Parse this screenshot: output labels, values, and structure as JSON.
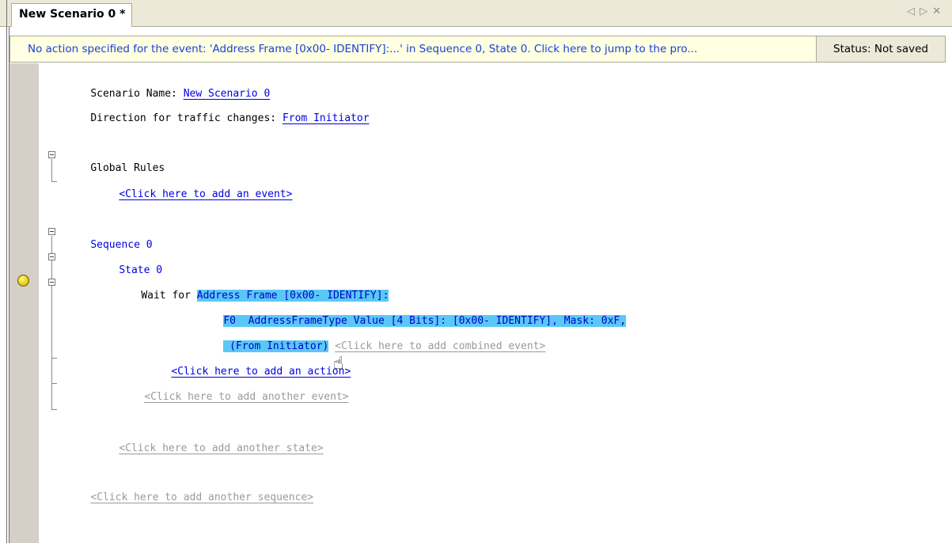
{
  "tab": {
    "title": "New Scenario 0 *",
    "nav_left": "◁",
    "nav_right": "▷",
    "close": "✕"
  },
  "infobar": {
    "message": "No action specified for the event: 'Address Frame [0x00- IDENTIFY]:...' in Sequence 0, State 0.  Click here to jump to the pro...",
    "status": "Status: Not saved"
  },
  "editor": {
    "scenario_name_label": "Scenario Name: ",
    "scenario_name_value": "New Scenario 0",
    "direction_label": "Direction for traffic changes: ",
    "direction_value": "From Initiator",
    "global_rules_label": "Global Rules",
    "add_event": "<Click here to add an event>",
    "sequence_label": "Sequence 0",
    "state_label": "State 0",
    "wait_for_label": "Wait for ",
    "event_line1": "Address Frame [0x00- IDENTIFY]:",
    "event_line2": "F0  AddressFrameType Value [4 Bits]: [0x00- IDENTIFY], Mask: 0xF,",
    "event_line3": " (From Initiator)",
    "add_combined_event": "<Click here to add combined event>",
    "add_action": "<Click here to add an action>",
    "add_another_event": "<Click here to add another event>",
    "add_another_state": "<Click here to add another state>",
    "add_another_sequence": "<Click here to add another sequence>"
  },
  "icons": {
    "breakpoint": "breakpoint-icon",
    "cursor": "☝"
  }
}
